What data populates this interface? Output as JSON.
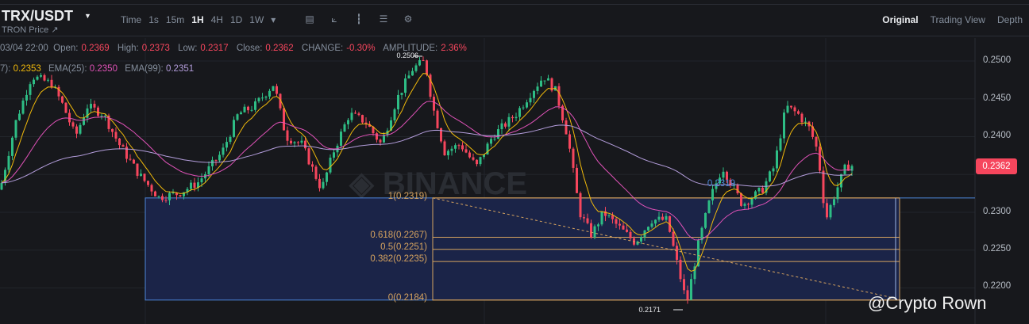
{
  "header": {
    "pair": "TRX/USDT",
    "subtitle": "TRON Price ↗",
    "timeframes": [
      "Time",
      "1s",
      "15m",
      "1H",
      "4H",
      "1D",
      "1W",
      "▾"
    ],
    "active_timeframe": "1H",
    "views": [
      "Original",
      "Trading View",
      "Depth"
    ],
    "active_view": "Original"
  },
  "ohlc": {
    "date": "03/04 22:00",
    "open_label": "Open:",
    "open": "0.2369",
    "high_label": "High:",
    "high": "0.2373",
    "low_label": "Low:",
    "low": "0.2317",
    "close_label": "Close:",
    "close": "0.2362",
    "change_label": "CHANGE:",
    "change": "-0.30%",
    "amplitude_label": "AMPLITUDE:",
    "amplitude": "2.36%"
  },
  "ema": {
    "ema7_label": "7):",
    "ema7": "0.2353",
    "ema25_label": "EMA(25):",
    "ema25": "0.2350",
    "ema99_label": "EMA(99):",
    "ema99": "0.2351"
  },
  "watermark": "@Crypto Rown",
  "colors": {
    "up": "#2ebd85",
    "down": "#f6465d",
    "ema7": "#f0b90b",
    "ema25": "#e052b8",
    "ema99": "#b39ddb",
    "fib": "#d6a35f",
    "rect": "#4d86d9"
  },
  "chart_data": {
    "type": "candlestick",
    "symbol": "TRX/USDT",
    "interval": "1H",
    "y_ticks": [
      "0.2500",
      "0.2450",
      "0.2400",
      "0.2300",
      "0.2250",
      "0.2200"
    ],
    "ylim": [
      0.2165,
      0.2515
    ],
    "current_price": "0.2362",
    "high_marker": "0.2506",
    "low_marker": "0.2171",
    "level_marker": "0.2319",
    "fib_levels": [
      {
        "label": "1(0.2319)",
        "value": 0.2319
      },
      {
        "label": "0.618(0.2267)",
        "value": 0.2267
      },
      {
        "label": "0.5(0.2251)",
        "value": 0.2251
      },
      {
        "label": "0.382(0.2235)",
        "value": 0.2235
      },
      {
        "label": "0(0.2184)",
        "value": 0.2184
      }
    ],
    "price_path": [
      [
        0,
        0.233
      ],
      [
        20,
        0.242
      ],
      [
        40,
        0.248
      ],
      [
        65,
        0.247
      ],
      [
        80,
        0.244
      ],
      [
        95,
        0.24
      ],
      [
        110,
        0.244
      ],
      [
        130,
        0.243
      ],
      [
        150,
        0.239
      ],
      [
        175,
        0.235
      ],
      [
        200,
        0.232
      ],
      [
        225,
        0.2325
      ],
      [
        250,
        0.234
      ],
      [
        280,
        0.238
      ],
      [
        300,
        0.243
      ],
      [
        320,
        0.244
      ],
      [
        345,
        0.247
      ],
      [
        360,
        0.24
      ],
      [
        380,
        0.239
      ],
      [
        405,
        0.233
      ],
      [
        420,
        0.238
      ],
      [
        440,
        0.243
      ],
      [
        460,
        0.242
      ],
      [
        480,
        0.239
      ],
      [
        500,
        0.245
      ],
      [
        520,
        0.249
      ],
      [
        535,
        0.25
      ],
      [
        545,
        0.244
      ],
      [
        560,
        0.238
      ],
      [
        580,
        0.239
      ],
      [
        600,
        0.236
      ],
      [
        620,
        0.24
      ],
      [
        650,
        0.243
      ],
      [
        670,
        0.246
      ],
      [
        685,
        0.248
      ],
      [
        700,
        0.246
      ],
      [
        715,
        0.24
      ],
      [
        730,
        0.23
      ],
      [
        745,
        0.227
      ],
      [
        760,
        0.23
      ],
      [
        790,
        0.227
      ],
      [
        800,
        0.226
      ],
      [
        820,
        0.229
      ],
      [
        840,
        0.229
      ],
      [
        860,
        0.22
      ],
      [
        865,
        0.218
      ],
      [
        880,
        0.226
      ],
      [
        895,
        0.232
      ],
      [
        910,
        0.236
      ],
      [
        920,
        0.234
      ],
      [
        935,
        0.231
      ],
      [
        960,
        0.233
      ],
      [
        975,
        0.236
      ],
      [
        990,
        0.244
      ],
      [
        1005,
        0.243
      ],
      [
        1020,
        0.241
      ],
      [
        1030,
        0.238
      ],
      [
        1040,
        0.229
      ],
      [
        1050,
        0.232
      ],
      [
        1065,
        0.236
      ],
      [
        1075,
        0.2362
      ]
    ]
  }
}
